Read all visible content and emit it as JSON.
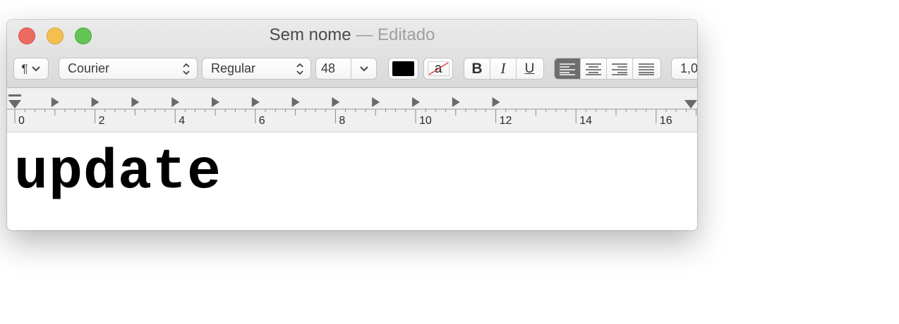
{
  "window": {
    "title": "Sem nome",
    "title_suffix": "— Editado"
  },
  "toolbar": {
    "paragraph_symbol": "¶",
    "font_family": "Courier",
    "font_style": "Regular",
    "font_size": "48",
    "text_color": "#000000",
    "highlight_glyph": "a",
    "bold_label": "B",
    "italic_label": "I",
    "underline_label": "U",
    "alignment_selected": "left",
    "line_spacing": "1,0"
  },
  "ruler": {
    "labels": [
      "0",
      "2",
      "4",
      "6",
      "8",
      "10",
      "12",
      "14",
      "16"
    ]
  },
  "document": {
    "text": "update"
  },
  "colors": {
    "close": "#ed6a5e",
    "minimize": "#f5bf4f",
    "zoom": "#62c554",
    "active_segment": "#6e6e6e"
  }
}
